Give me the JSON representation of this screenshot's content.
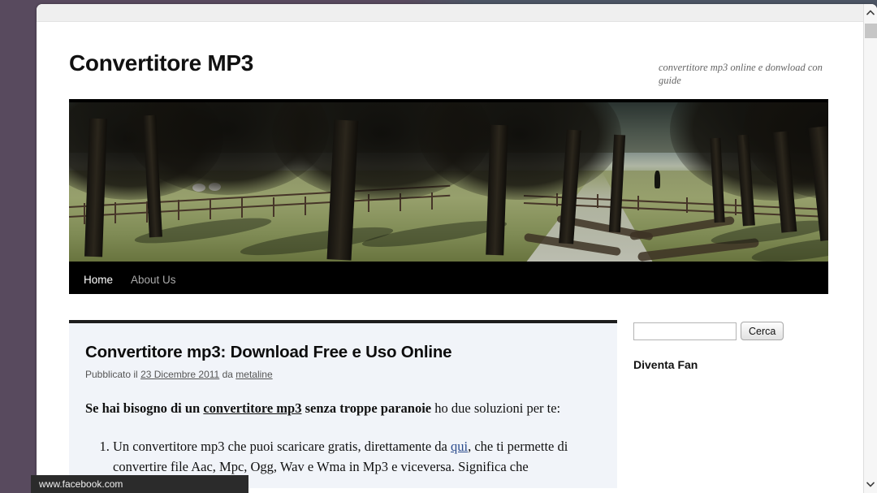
{
  "background": {
    "left_color": "#584a5e",
    "right_color": "#4c5564"
  },
  "browser": {
    "status_bar_url": "www.facebook.com",
    "scrollbar": {
      "up_arrow": "chevron-up-icon",
      "down_arrow": "chevron-down-icon"
    }
  },
  "site": {
    "title": "Convertitore MP3",
    "description": "convertitore mp3 online e donwload con guide",
    "nav": [
      {
        "label": "Home",
        "active": true
      },
      {
        "label": "About Us",
        "active": false
      }
    ],
    "banner_alt": "tree-lined gravel path with fence, grazing sheep and a person walking"
  },
  "post": {
    "title": "Convertitore mp3: Download Free e Uso Online",
    "meta_prefix": "Pubblicato il",
    "date": "23 Dicembre 2011",
    "meta_by": "da",
    "author": "metaline",
    "lead_bold_1": "Se hai bisogno di un ",
    "lead_link": "convertitore mp3",
    "lead_bold_2": " senza troppe paranoie",
    "lead_rest": " ho due soluzioni per te:",
    "list": [
      {
        "text_before_link": "Un convertitore mp3 che puoi scaricare gratis, direttamente da ",
        "link": "qui",
        "text_after_link": ", che ti permette di convertire file Aac, Mpc, Ogg, Wav e Wma in Mp3 e viceversa. Significa che"
      }
    ]
  },
  "sidebar": {
    "search": {
      "value": "",
      "placeholder": "",
      "button_label": "Cerca"
    },
    "widgets": [
      {
        "title": "Diventa Fan"
      }
    ]
  }
}
